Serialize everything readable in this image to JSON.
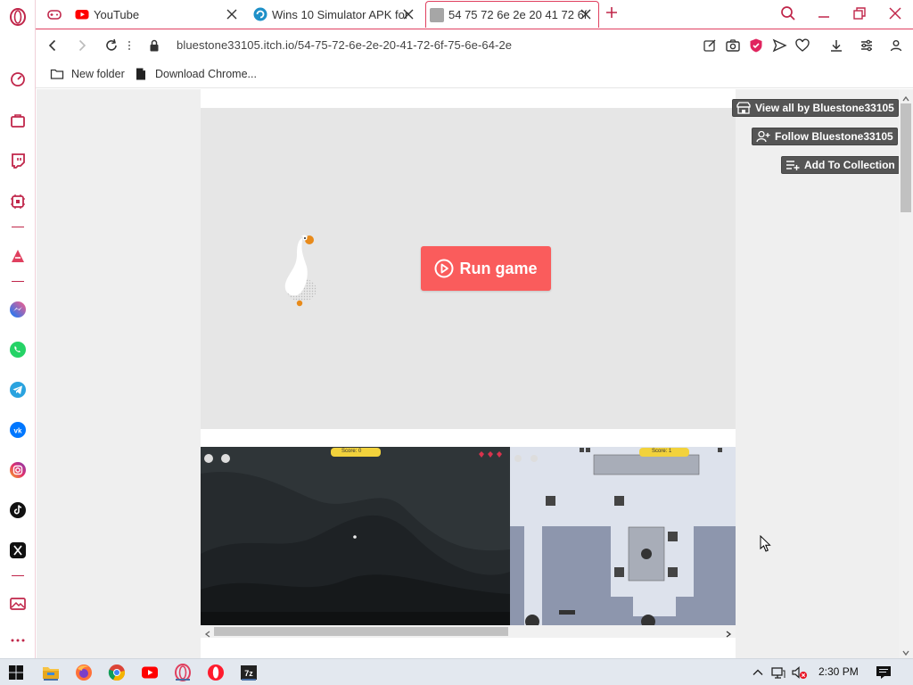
{
  "browser": {
    "tabs": [
      {
        "label": "YouTube",
        "favicon": "youtube-icon"
      },
      {
        "label": "Wins 10 Simulator APK for",
        "favicon": "app-icon"
      },
      {
        "label": "54 75 72 6e 2e 20 41 72 6f",
        "favicon": "blank-page-icon"
      }
    ],
    "url": "bluestone33105.itch.io/54-75-72-6e-2e-20-41-72-6f-75-6e-64-2e",
    "bookmarks": [
      {
        "label": "New folder",
        "icon": "folder-icon"
      },
      {
        "label": "Download Chrome...",
        "icon": "document-icon"
      }
    ],
    "accent": "#e0405f"
  },
  "page": {
    "run_button_label": "Run game",
    "view_all_label": "View all by Bluestone33105",
    "follow_label": "Follow Bluestone33105",
    "collection_label": "Add To Collection",
    "run_button_color": "#fa5c5c",
    "shot1_score": "Score: 0",
    "shot2_score": "Score: 1"
  },
  "taskbar": {
    "time": "2:30 PM"
  }
}
